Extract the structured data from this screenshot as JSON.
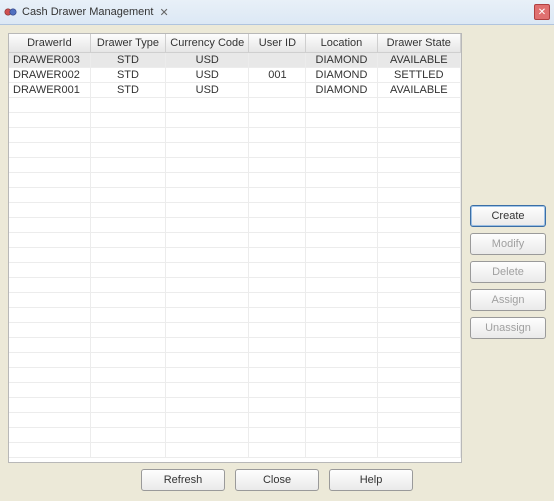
{
  "window": {
    "title": "Cash Drawer Management",
    "tab_close_glyph": "✕",
    "close_glyph": "✕"
  },
  "table": {
    "columns": [
      "DrawerId",
      "Drawer Type",
      "Currency Code",
      "User ID",
      "Location",
      "Drawer State"
    ],
    "rows": [
      {
        "drawer_id": "DRAWER003",
        "drawer_type": "STD",
        "currency": "USD",
        "user_id": "",
        "location": "DIAMOND",
        "state": "AVAILABLE",
        "selected": true
      },
      {
        "drawer_id": "DRAWER002",
        "drawer_type": "STD",
        "currency": "USD",
        "user_id": "001",
        "location": "DIAMOND",
        "state": "SETTLED",
        "selected": false
      },
      {
        "drawer_id": "DRAWER001",
        "drawer_type": "STD",
        "currency": "USD",
        "user_id": "",
        "location": "DIAMOND",
        "state": "AVAILABLE",
        "selected": false
      }
    ]
  },
  "side_buttons": {
    "create": {
      "label": "Create",
      "enabled": true
    },
    "modify": {
      "label": "Modify",
      "enabled": false
    },
    "delete": {
      "label": "Delete",
      "enabled": false
    },
    "assign": {
      "label": "Assign",
      "enabled": false
    },
    "unassign": {
      "label": "Unassign",
      "enabled": false
    }
  },
  "bottom_buttons": {
    "refresh": "Refresh",
    "close": "Close",
    "help": "Help"
  }
}
